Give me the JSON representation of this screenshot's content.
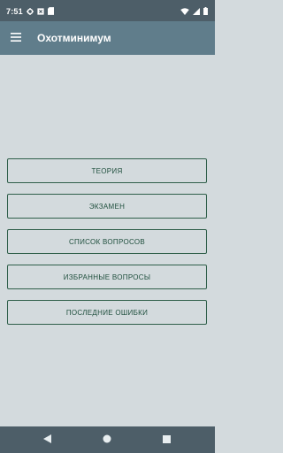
{
  "status_bar": {
    "time": "7:51",
    "left_icons": [
      "gear-icon",
      "notification-x-icon",
      "sd-card-icon"
    ],
    "right_icons": [
      "wifi-icon",
      "signal-icon",
      "battery-icon"
    ]
  },
  "app_bar": {
    "menu_icon": "hamburger-menu-icon",
    "title": "Охотминимум"
  },
  "menu": {
    "items": [
      {
        "label": "ТЕОРИЯ"
      },
      {
        "label": "ЭКЗАМЕН"
      },
      {
        "label": "СПИСОК ВОПРОСОВ"
      },
      {
        "label": "ИЗБРАННЫЕ ВОПРОСЫ"
      },
      {
        "label": "ПОСЛЕДНИЕ ОШИБКИ"
      }
    ]
  },
  "nav_bar": {
    "icons": [
      "back-triangle-icon",
      "home-circle-icon",
      "recents-square-icon"
    ]
  },
  "colors": {
    "status_bar": "#4d5e68",
    "app_bar": "#607d8b",
    "background": "#d3dadd",
    "button_border": "#2f5f4a",
    "button_text": "#1f4f3d"
  }
}
